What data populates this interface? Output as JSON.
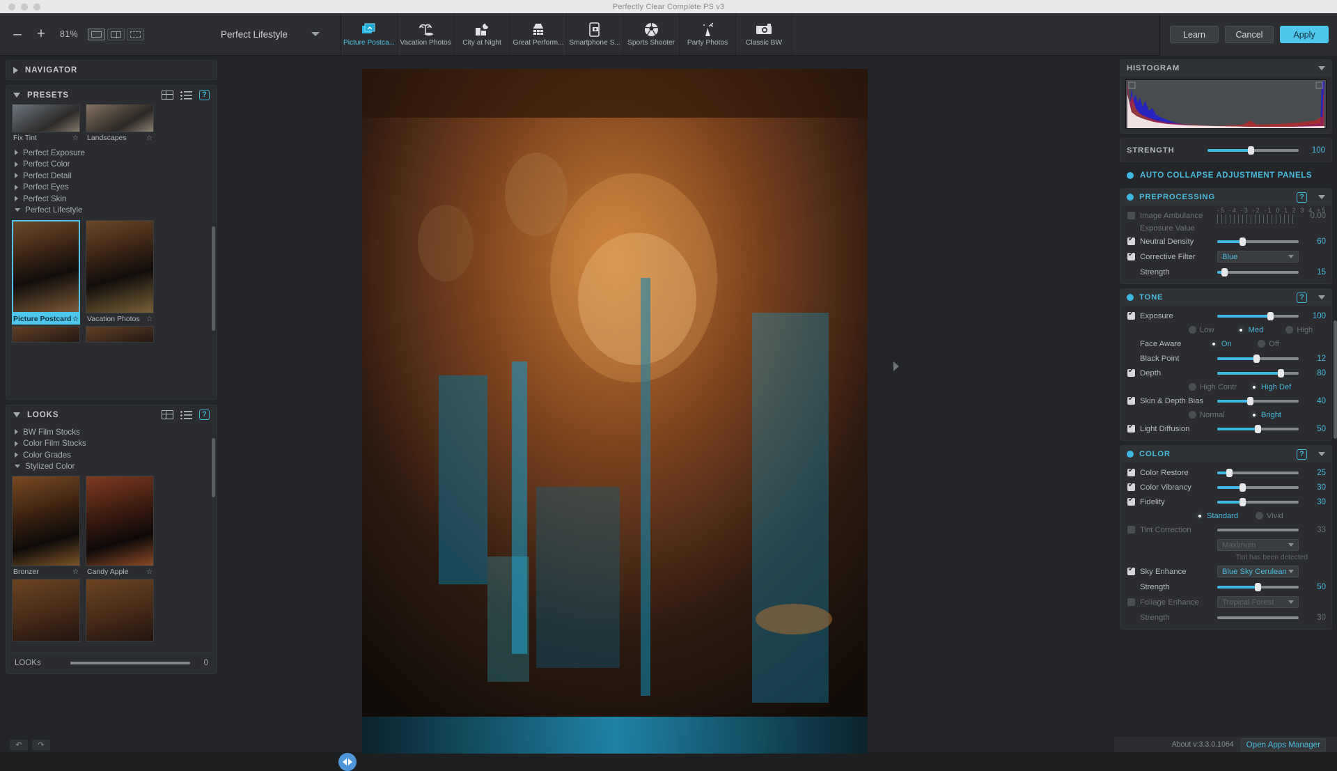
{
  "window": {
    "title": "Perfectly Clear Complete PS v3"
  },
  "toolbar": {
    "zoom_out": "–",
    "zoom_in": "+",
    "zoom_value": "81%",
    "view_modes": [
      "single-view",
      "split-view",
      "side-by-side-view"
    ],
    "preset_dropdown": "Perfect Lifestyle",
    "tabs": [
      {
        "label": "Picture Postca...",
        "icon": "postcard-icon",
        "active": true
      },
      {
        "label": "Vacation Photos",
        "icon": "palm-tree-icon",
        "active": false
      },
      {
        "label": "City at Night",
        "icon": "city-night-icon",
        "active": false
      },
      {
        "label": "Great Perform...",
        "icon": "stage-light-icon",
        "active": false
      },
      {
        "label": "Smartphone S...",
        "icon": "smartphone-icon",
        "active": false
      },
      {
        "label": "Sports Shooter",
        "icon": "soccer-ball-icon",
        "active": false
      },
      {
        "label": "Party Photos",
        "icon": "party-hat-icon",
        "active": false
      },
      {
        "label": "Classic BW",
        "icon": "camera-icon",
        "active": false
      }
    ],
    "learn": "Learn",
    "cancel": "Cancel",
    "apply": "Apply"
  },
  "left": {
    "navigator": {
      "title": "NAVIGATOR"
    },
    "presets": {
      "title": "PRESETS",
      "top_thumbs": [
        {
          "label": "Fix Tint",
          "selected": false
        },
        {
          "label": "Landscapes",
          "selected": false
        }
      ],
      "groups": [
        {
          "label": "Perfect Exposure",
          "open": false
        },
        {
          "label": "Perfect Color",
          "open": false
        },
        {
          "label": "Perfect Detail",
          "open": false
        },
        {
          "label": "Perfect Eyes",
          "open": false
        },
        {
          "label": "Perfect Skin",
          "open": false
        },
        {
          "label": "Perfect Lifestyle",
          "open": true
        }
      ],
      "lifestyle_thumbs": [
        {
          "label": "Picture Postcard",
          "selected": true
        },
        {
          "label": "Vacation Photos",
          "selected": false
        }
      ]
    },
    "looks": {
      "title": "LOOKS",
      "groups": [
        {
          "label": "BW Film Stocks",
          "open": false
        },
        {
          "label": "Color Film Stocks",
          "open": false
        },
        {
          "label": "Color Grades",
          "open": false
        },
        {
          "label": "Stylized Color",
          "open": true
        }
      ],
      "thumbs": [
        {
          "label": "Bronzer",
          "selected": false
        },
        {
          "label": "Candy Apple",
          "selected": false
        }
      ],
      "slider_label": "LOOKs",
      "slider_value": "0"
    },
    "undo": "↶",
    "redo": "↷"
  },
  "right": {
    "histogram": {
      "title": "HISTOGRAM"
    },
    "strength": {
      "label": "STRENGTH",
      "value": "100"
    },
    "auto_collapse": {
      "label": "AUTO COLLAPSE ADJUSTMENT PANELS",
      "enabled": true
    },
    "preprocessing": {
      "title": "PREPROCESSING",
      "image_ambulance": {
        "label": "Image Ambulance",
        "checked": false,
        "enabled": false
      },
      "exposure_value": {
        "label": "Exposure Value",
        "value": "0.00",
        "ruler": "-5 -4 -3 -2 -1 0 1 2 3 4 +5"
      },
      "neutral_density": {
        "label": "Neutral Density",
        "checked": true,
        "value": "60"
      },
      "corrective_filter": {
        "label": "Corrective Filter",
        "checked": true,
        "value": "Blue"
      },
      "corrective_strength": {
        "label": "Strength",
        "value": "15"
      }
    },
    "tone": {
      "title": "TONE",
      "exposure": {
        "label": "Exposure",
        "checked": true,
        "value": "100",
        "options": [
          "Low",
          "Med",
          "High"
        ],
        "selected": "Med"
      },
      "face_aware": {
        "label": "Face Aware",
        "options": [
          "On",
          "Off"
        ],
        "selected": "On"
      },
      "black_point": {
        "label": "Black Point",
        "value": "12"
      },
      "depth": {
        "label": "Depth",
        "checked": true,
        "value": "80",
        "options": [
          "High Contr",
          "High Def"
        ],
        "selected": "High Def"
      },
      "skin_depth_bias": {
        "label": "Skin & Depth Bias",
        "checked": true,
        "value": "40",
        "options": [
          "Normal",
          "Bright"
        ],
        "selected": "Bright"
      },
      "light_diffusion": {
        "label": "Light Diffusion",
        "checked": true,
        "value": "50"
      }
    },
    "color": {
      "title": "COLOR",
      "color_restore": {
        "label": "Color Restore",
        "checked": true,
        "value": "25"
      },
      "color_vibrancy": {
        "label": "Color Vibrancy",
        "checked": true,
        "value": "30"
      },
      "fidelity": {
        "label": "Fidelity",
        "checked": true,
        "value": "30",
        "options": [
          "Standard",
          "Vivid"
        ],
        "selected": "Standard"
      },
      "tint_correction": {
        "label": "Tint Correction",
        "checked": false,
        "value": "33",
        "dropdown": "Maximum",
        "note": "Tint has been detected"
      },
      "sky_enhance": {
        "label": "Sky Enhance",
        "checked": true,
        "value": "Blue Sky Cerulean"
      },
      "sky_strength": {
        "label": "Strength",
        "value": "50"
      },
      "foliage_enhance": {
        "label": "Foliage Enhance",
        "checked": false,
        "value": "Tropical Forest"
      },
      "foliage_strength": {
        "label": "Strength",
        "value": "30"
      }
    },
    "status": {
      "about": "About v:3.3.0.1064",
      "apps_manager": "Open Apps Manager"
    }
  },
  "colors": {
    "accent": "#49b9dd",
    "apply_button": "#4fc6ec",
    "panel_bg": "#2a2c2f",
    "app_bg": "#232528"
  }
}
